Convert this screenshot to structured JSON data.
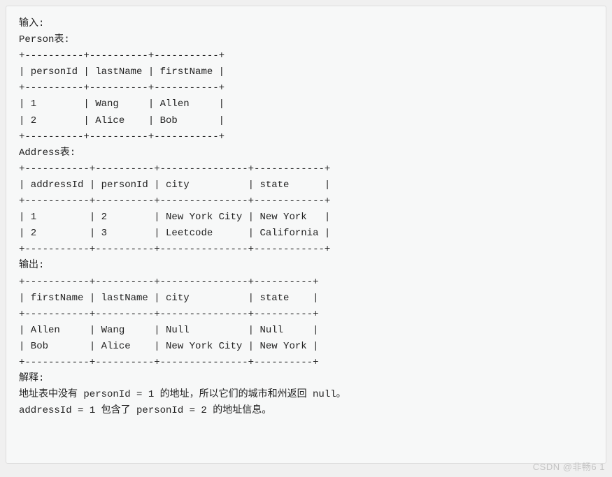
{
  "labels": {
    "input_header": "输入: ",
    "person_table_label": "Person表:",
    "address_table_label": "Address表:",
    "output_header": "输出: ",
    "explain_header": "解释:",
    "explain_line1": "地址表中没有 personId = 1 的地址，所以它们的城市和州返回 null。",
    "explain_line2": "addressId = 1 包含了 personId = 2 的地址信息。"
  },
  "person_table": {
    "border": "+----------+----------+-----------+",
    "header": "| personId | lastName | firstName |",
    "rows": [
      "| 1        | Wang     | Allen     |",
      "| 2        | Alice    | Bob       |"
    ]
  },
  "address_table": {
    "border": "+-----------+----------+---------------+------------+",
    "header": "| addressId | personId | city          | state      |",
    "rows": [
      "| 1         | 2        | New York City | New York   |",
      "| 2         | 3        | Leetcode      | California |"
    ]
  },
  "output_table": {
    "border": "+-----------+----------+---------------+----------+",
    "header": "| firstName | lastName | city          | state    |",
    "rows": [
      "| Allen     | Wang     | Null          | Null     |",
      "| Bob       | Alice    | New York City | New York |"
    ]
  },
  "watermark": "CSDN @非畅6 1",
  "chart_data": {
    "type": "table",
    "tables": [
      {
        "name": "Person",
        "columns": [
          "personId",
          "lastName",
          "firstName"
        ],
        "rows": [
          [
            1,
            "Wang",
            "Allen"
          ],
          [
            2,
            "Alice",
            "Bob"
          ]
        ]
      },
      {
        "name": "Address",
        "columns": [
          "addressId",
          "personId",
          "city",
          "state"
        ],
        "rows": [
          [
            1,
            2,
            "New York City",
            "New York"
          ],
          [
            2,
            3,
            "Leetcode",
            "California"
          ]
        ]
      },
      {
        "name": "Output",
        "columns": [
          "firstName",
          "lastName",
          "city",
          "state"
        ],
        "rows": [
          [
            "Allen",
            "Wang",
            null,
            null
          ],
          [
            "Bob",
            "Alice",
            "New York City",
            "New York"
          ]
        ]
      }
    ]
  }
}
